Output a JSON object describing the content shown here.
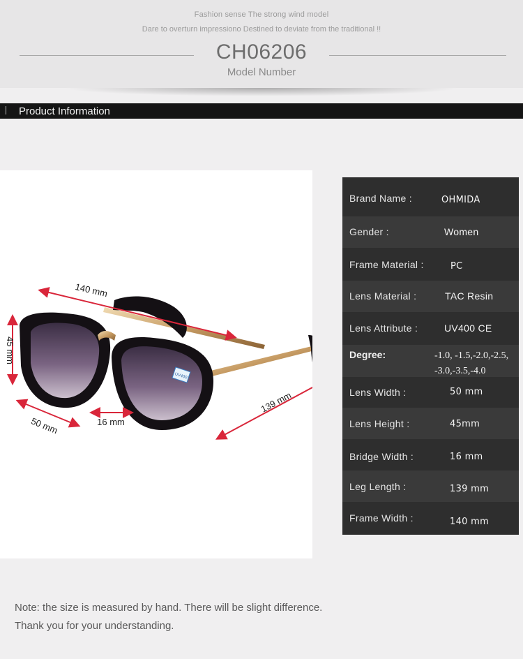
{
  "header": {
    "tagline_1": "Fashion sense The strong wind model",
    "tagline_2": "Dare to overturn impressiono Destined to deviate from the traditional !!",
    "model_code": "CH06206",
    "model_label": "Model Number"
  },
  "section": {
    "title": "Product Information"
  },
  "dimensions": {
    "frame_width": "140 mm",
    "lens_height": "45 mm",
    "lens_width": "50 mm",
    "bridge_width": "16 mm",
    "leg_length": "139 mm",
    "lens_sticker": "UV400"
  },
  "spec": {
    "brand_label": "Brand Name :",
    "brand_value": "OHMIDA",
    "gender_label": "Gender :",
    "gender_value": "Women",
    "frame_material_label": "Frame Material :",
    "frame_material_value": "PC",
    "lens_material_label": "Lens Material :",
    "lens_material_value": "TAC Resin",
    "lens_attribute_label": "Lens Attribute :",
    "lens_attribute_value": "UV400 CE",
    "degree_label": "Degree:",
    "degree_value_1": "-1.0, -1.5,-2.0,-2.5,",
    "degree_value_2": "-3.0,-3.5,-4.0",
    "lens_width_label": "Lens Width :",
    "lens_width_value": "50 mm",
    "lens_height_label": "Lens Height :",
    "lens_height_value": "45mm",
    "bridge_width_label": "Bridge Width :",
    "bridge_width_value": "16 mm",
    "leg_length_label": "Leg Length :",
    "leg_length_value": "139 mm",
    "frame_width_label": "Frame Width :",
    "frame_width_value": "140 mm"
  },
  "notes": {
    "line_1": "Note: the size is measured by hand. There will be slight difference.",
    "line_2": "Thank you for your understanding."
  },
  "colors": {
    "arrow": "#d9263a",
    "frame": "#141014",
    "lens": "#6a4f70",
    "metal": "#c9a472"
  }
}
